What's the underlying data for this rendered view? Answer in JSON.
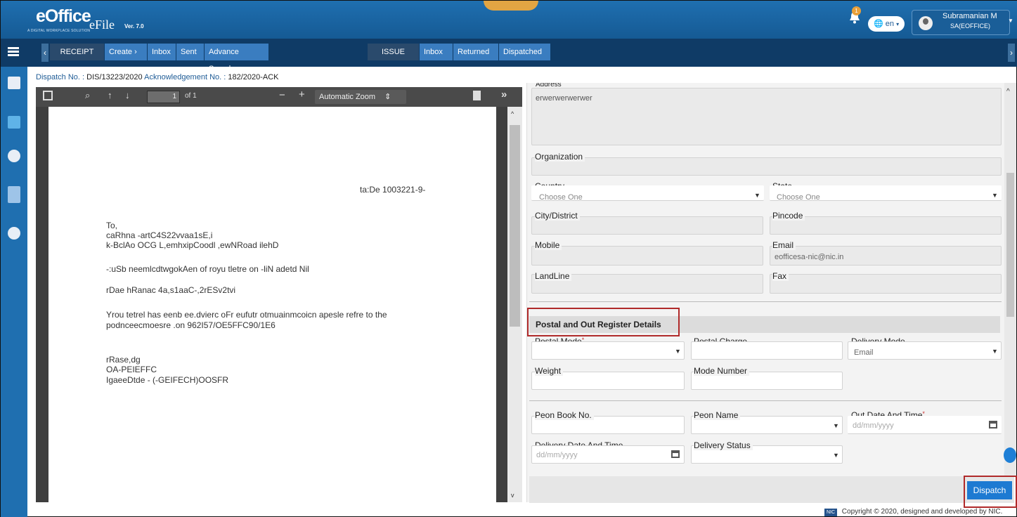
{
  "header": {
    "logo_text": "eOffice",
    "logo_tagline": "A DIGITAL WORKPLACE SOLUTION",
    "app_name": "eFile",
    "version": "Ver. 7.0",
    "notification_count": "1",
    "language": "en",
    "user_name": "Subramanian M",
    "user_role": "SA(EOFFICE)"
  },
  "nav": {
    "receipt": "RECEIPT",
    "create": "Create",
    "inbox": "Inbox",
    "sent": "Sent",
    "advance_search": "Advance Search",
    "issue": "ISSUE",
    "issue_inbox": "Inbox",
    "returned": "Returned",
    "dispatched": "Dispatched"
  },
  "breadcrumb": {
    "dispatch_label": "Dispatch No. :",
    "dispatch_no": "DIS/13223/2020",
    "ack_label": "Acknowledgement No. :",
    "ack_no": "182/2020-ACK"
  },
  "pdf_viewer": {
    "page_number": "1",
    "page_total": "of 1",
    "zoom": "Automatic Zoom",
    "content": {
      "ref": "ta:De 1003221-9-",
      "line1": "To,",
      "line2": "caRhna -artC4S22vvaa1sE,i",
      "line3": "k-BclAo OCG L,emhxipCoodl ,ewNRoad ilehD",
      "line4": "-:uSb neemlcdtwgokAen of royu tletre on -liN adetd Nil",
      "line5": "rDae hRanac 4a,s1aaC-,2rESv2tvi",
      "line6": "Yrou tetrel has eenb ee.dvierc oFr eufutr otmuainmcoicn apesle refre to the",
      "line7": "podnceecmoesre .on 962I57/OE5FFC90/1E6",
      "line8": "rRase,dg",
      "line9": "OA-PEIEFFC",
      "line10": "IgaeeDtde - (-GEIFECH)OOSFR"
    }
  },
  "form": {
    "address_label": "Address",
    "address_value": "erwerwerwerwer",
    "organization_label": "Organization",
    "country_label": "Country",
    "country_value": "Choose One",
    "state_label": "State",
    "state_value": "Choose One",
    "city_label": "City/District",
    "pincode_label": "Pincode",
    "mobile_label": "Mobile",
    "email_label": "Email",
    "email_value": "eofficesa-nic@nic.in",
    "landline_label": "LandLine",
    "fax_label": "Fax",
    "postal_section_title": "Postal and Out Register Details",
    "postal_mode_label": "Postal Mode",
    "required_mark": "*",
    "postal_charge_label": "Postal Charge",
    "delivery_mode_label": "Delivery Mode",
    "delivery_mode_value": "Email",
    "weight_label": "Weight",
    "mode_number_label": "Mode Number",
    "peon_book_label": "Peon Book No.",
    "peon_name_label": "Peon Name",
    "out_date_label": "Out Date And Time",
    "out_date_placeholder": "dd/mm/yyyy",
    "delivery_date_label": "Delivery Date And Time",
    "delivery_date_placeholder": "dd/mm/yyyy",
    "delivery_status_label": "Delivery Status",
    "dispatch_button": "Dispatch"
  },
  "footer": {
    "nic_logo": "NIC",
    "copyright": "Copyright © 2020, designed and developed by NIC."
  }
}
